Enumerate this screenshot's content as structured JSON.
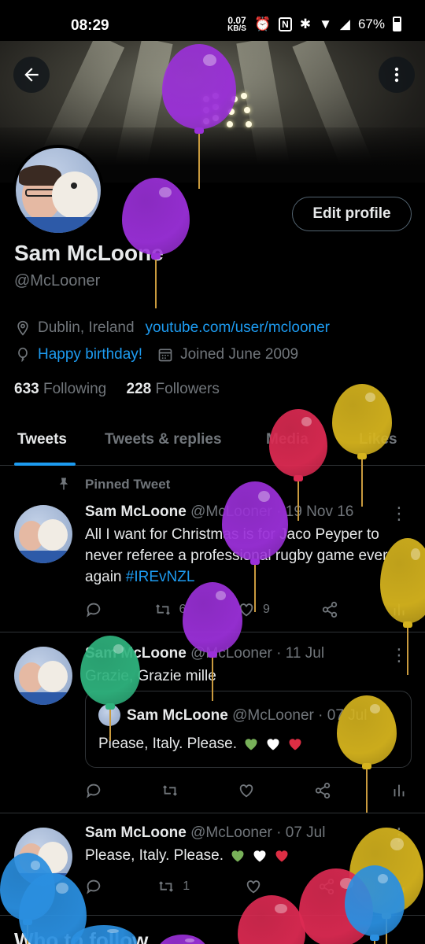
{
  "status": {
    "time": "08:29",
    "speed_value": "0.07",
    "speed_unit": "KB/S",
    "battery": "67%"
  },
  "profile": {
    "name": "Sam McLoone",
    "handle": "@McLooner",
    "location": "Dublin, Ireland",
    "website": "youtube.com/user/mclooner",
    "birthday": "Happy birthday!",
    "joined": "Joined June 2009",
    "following_count": "633",
    "following_label": "Following",
    "followers_count": "228",
    "followers_label": "Followers",
    "edit_label": "Edit profile"
  },
  "tabs": [
    "Tweets",
    "Tweets & replies",
    "Media",
    "Likes"
  ],
  "tweets": [
    {
      "pinned_label": "Pinned Tweet",
      "name": "Sam McLoone",
      "handle": "@McLooner",
      "date": "· 19 Nov 16",
      "text": "All I want for Christmas is for Jaco Peyper to never referee a professional rugby game ever again",
      "hashtag": "#IREvNZL",
      "retweets": "6",
      "likes": "9"
    },
    {
      "name": "Sam McLoone",
      "handle": "@McLooner",
      "date": "· 11 Jul",
      "text": "Grazie, Grazie mille",
      "quote": {
        "name": "Sam McLoone",
        "handle": "@McLooner",
        "date": "· 07 Jul",
        "text": "Please, Italy. Please."
      }
    },
    {
      "name": "Sam McLoone",
      "handle": "@McLooner",
      "date": "· 07 Jul",
      "text": "Please, Italy. Please.",
      "retweets": "1"
    }
  ],
  "footer": {
    "title": "Who to follow"
  },
  "icons": {
    "back": "arrow-left-icon",
    "more": "more-vertical-icon",
    "location": "location-pin-icon",
    "birthday": "balloon-icon",
    "calendar": "calendar-icon"
  },
  "colors": {
    "accent": "#1d9bf0",
    "text": "#e7e9ea",
    "muted": "#71767b",
    "divider": "#2f3336"
  }
}
